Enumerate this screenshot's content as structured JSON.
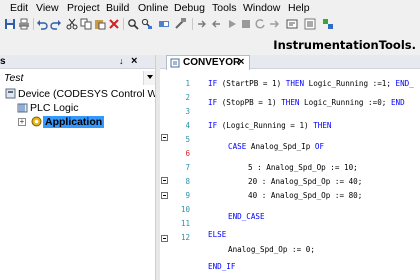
{
  "menu": [
    "Edit",
    "View",
    "Project",
    "Build",
    "Online",
    "Debug",
    "Tools",
    "Window",
    "Help"
  ],
  "watermark": "InstrumentationTools.",
  "devices_pane": {
    "header_fragment": "s",
    "pin_glyph": "↓",
    "close_glyph": "×",
    "project_name": "Test",
    "tree": [
      {
        "label": "Device (CODESYS Control Win V3)",
        "icon": "device-icon"
      },
      {
        "label": "PLC Logic",
        "icon": "plc-logic-icon"
      },
      {
        "label": "Application",
        "icon": "application-icon",
        "selected": true
      }
    ]
  },
  "editor": {
    "tab_label": "CONVEYOR",
    "tab_close_glyph": "×",
    "line_numbers": [
      "1",
      "2",
      "3",
      "4",
      "5",
      "6",
      "7",
      "8",
      "9",
      "10",
      "11",
      "12"
    ],
    "code": [
      {
        "parts": [
          [
            "kw",
            "IF"
          ],
          [
            "t",
            " (StartPB = "
          ],
          [
            "num",
            "1"
          ],
          [
            "t",
            ") "
          ],
          [
            "kw",
            "THEN"
          ],
          [
            "t",
            " Logic_Running :="
          ],
          [
            "num",
            "1"
          ],
          [
            "t",
            "; "
          ],
          [
            "kw",
            "END_"
          ]
        ]
      },
      {
        "parts": [
          [
            "kw",
            "IF"
          ],
          [
            "t",
            " (StopPB = "
          ],
          [
            "num",
            "1"
          ],
          [
            "t",
            ") "
          ],
          [
            "kw",
            "THEN"
          ],
          [
            "t",
            " Logic_Running :="
          ],
          [
            "num",
            "0"
          ],
          [
            "t",
            "; "
          ],
          [
            "kw",
            "END"
          ]
        ]
      },
      {
        "parts": [
          [
            "kw",
            "IF"
          ],
          [
            "t",
            " (Logic_Running = "
          ],
          [
            "num",
            "1"
          ],
          [
            "t",
            ") "
          ],
          [
            "kw",
            "THEN"
          ]
        ]
      },
      {
        "parts": [
          [
            "kw",
            "CASE"
          ],
          [
            "t",
            " Analog_Spd_Ip "
          ],
          [
            "kw",
            "OF"
          ]
        ]
      },
      {
        "parts": [
          [
            "num",
            "5"
          ],
          [
            "t",
            " : Analog_Spd_Op := "
          ],
          [
            "num",
            "10"
          ],
          [
            "t",
            ";"
          ]
        ]
      },
      {
        "parts": [
          [
            "num",
            "20"
          ],
          [
            "t",
            " : Analog_Spd_Op := "
          ],
          [
            "num",
            "40"
          ],
          [
            "t",
            ";"
          ]
        ]
      },
      {
        "parts": [
          [
            "num",
            "40"
          ],
          [
            "t",
            " : Analog_Spd_Op := "
          ],
          [
            "num",
            "80"
          ],
          [
            "t",
            ";"
          ]
        ]
      },
      {
        "parts": [
          [
            "kw",
            "END_CASE"
          ]
        ]
      },
      {
        "parts": [
          [
            "kw",
            "ELSE"
          ]
        ]
      },
      {
        "parts": [
          [
            "t",
            "Analog_Spd_Op := "
          ],
          [
            "num",
            "0"
          ],
          [
            "t",
            ";"
          ]
        ]
      },
      {
        "parts": [
          [
            "kw",
            "END_IF"
          ]
        ]
      }
    ]
  }
}
